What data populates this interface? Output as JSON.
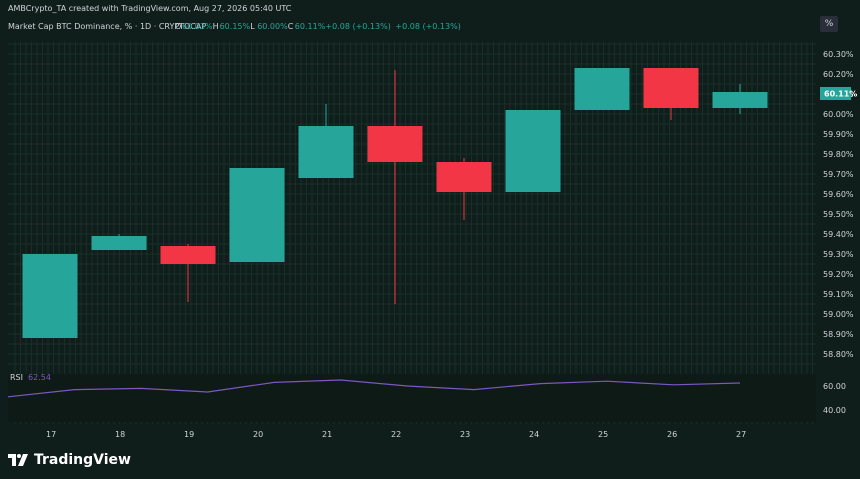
{
  "header": {
    "attribution": "AMBCrypto_TA created with TradingView.com, Aug 27, 2026 05:40 UTC",
    "symbol": "Market Cap BTC Dominance, % · 1D · CRYPTOCAP",
    "ohlc": [
      {
        "key": "O",
        "value": "60.03%"
      },
      {
        "key": "H",
        "value": "60.15%"
      },
      {
        "key": "L",
        "value": "60.00%"
      },
      {
        "key": "C",
        "value": "60.11%"
      }
    ],
    "change": "+0.08 (+0.13%)",
    "change2": "+0.08 (+0.13%)"
  },
  "percent_button": "%",
  "price_axis": {
    "ticks": [
      "60.30%",
      "60.20%",
      "60.10%",
      "60.00%",
      "59.90%",
      "59.80%",
      "59.70%",
      "59.60%",
      "59.50%",
      "59.40%",
      "59.30%",
      "59.20%",
      "59.10%",
      "59.00%",
      "58.90%",
      "58.80%"
    ],
    "last_price_label": "60.11%"
  },
  "time_axis": {
    "ticks": [
      "17",
      "18",
      "19",
      "20",
      "21",
      "22",
      "23",
      "24",
      "25",
      "26",
      "27"
    ]
  },
  "rsi": {
    "label": "RSI",
    "value": "62.54",
    "ticks": [
      "60.00",
      "40.00"
    ]
  },
  "branding": {
    "logo_text": "TradingView"
  },
  "colors": {
    "background": "#0f1e1a",
    "up": "#26a69a",
    "down": "#f23645",
    "rsi_line": "#7e57c2",
    "text": "#d1d4dc"
  },
  "chart_data": {
    "type": "candlestick",
    "x": [
      "17",
      "18",
      "19",
      "20",
      "21",
      "22",
      "23",
      "24",
      "25",
      "26",
      "27"
    ],
    "open": [
      58.88,
      59.32,
      59.34,
      59.26,
      59.68,
      59.94,
      59.76,
      59.61,
      60.02,
      60.23,
      60.03
    ],
    "high": [
      59.3,
      59.4,
      59.35,
      59.73,
      60.05,
      60.22,
      59.78,
      60.02,
      60.23,
      60.23,
      60.15
    ],
    "low": [
      58.88,
      59.32,
      59.06,
      59.26,
      59.68,
      59.05,
      59.47,
      59.61,
      60.02,
      59.97,
      60.0
    ],
    "close": [
      59.3,
      59.39,
      59.25,
      59.73,
      59.94,
      59.76,
      59.61,
      60.02,
      60.23,
      60.03,
      60.11
    ],
    "ylim": [
      58.73,
      60.35
    ],
    "rsi": {
      "values": [
        51,
        57,
        58,
        55,
        63,
        65,
        60,
        57,
        62,
        64,
        61,
        62.5
      ],
      "ylim": [
        30,
        70
      ]
    }
  }
}
